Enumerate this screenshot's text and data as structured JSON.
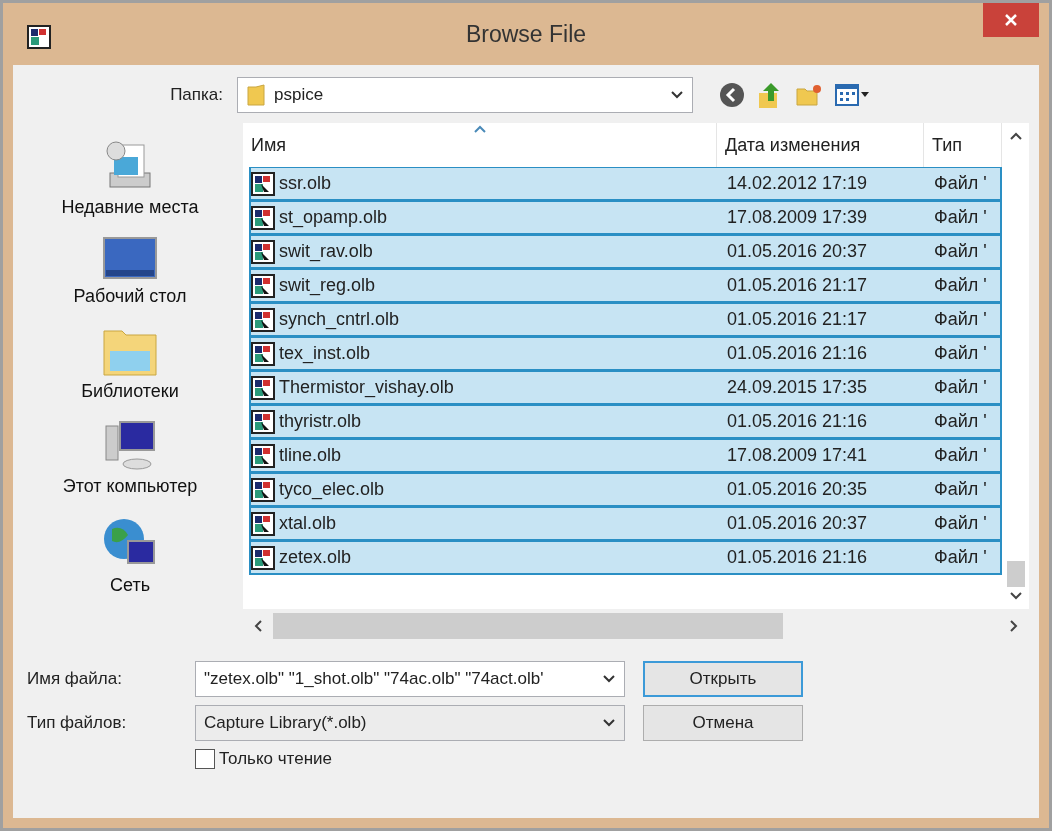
{
  "window": {
    "title": "Browse File"
  },
  "folder": {
    "label": "Папка:",
    "value": "pspice"
  },
  "places": [
    {
      "label": "Недавние места",
      "kind": "recent"
    },
    {
      "label": "Рабочий стол",
      "kind": "desktop"
    },
    {
      "label": "Библиотеки",
      "kind": "libraries"
    },
    {
      "label": "Этот компьютер",
      "kind": "computer"
    },
    {
      "label": "Сеть",
      "kind": "network"
    }
  ],
  "file_list": {
    "columns": [
      {
        "label": "Имя",
        "sorted": true
      },
      {
        "label": "Дата изменения",
        "sorted": false
      },
      {
        "label": "Тип",
        "sorted": false
      }
    ],
    "rows": [
      {
        "name": "ssr.olb",
        "date": "14.02.2012 17:19",
        "type": "Файл '",
        "selected": true
      },
      {
        "name": "st_opamp.olb",
        "date": "17.08.2009 17:39",
        "type": "Файл '",
        "selected": true
      },
      {
        "name": "swit_rav.olb",
        "date": "01.05.2016 20:37",
        "type": "Файл '",
        "selected": true
      },
      {
        "name": "swit_reg.olb",
        "date": "01.05.2016 21:17",
        "type": "Файл '",
        "selected": true
      },
      {
        "name": "synch_cntrl.olb",
        "date": "01.05.2016 21:17",
        "type": "Файл '",
        "selected": true
      },
      {
        "name": "tex_inst.olb",
        "date": "01.05.2016 21:16",
        "type": "Файл '",
        "selected": true
      },
      {
        "name": "Thermistor_vishay.olb",
        "date": "24.09.2015 17:35",
        "type": "Файл '",
        "selected": true
      },
      {
        "name": "thyristr.olb",
        "date": "01.05.2016 21:16",
        "type": "Файл '",
        "selected": true
      },
      {
        "name": "tline.olb",
        "date": "17.08.2009 17:41",
        "type": "Файл '",
        "selected": true
      },
      {
        "name": "tyco_elec.olb",
        "date": "01.05.2016 20:35",
        "type": "Файл '",
        "selected": true
      },
      {
        "name": "xtal.olb",
        "date": "01.05.2016 20:37",
        "type": "Файл '",
        "selected": true
      },
      {
        "name": "zetex.olb",
        "date": "01.05.2016 21:16",
        "type": "Файл '",
        "selected": true
      }
    ]
  },
  "file_name": {
    "label": "Имя файла:",
    "value": "\"zetex.olb\" \"1_shot.olb\" \"74ac.olb\" \"74act.olb'"
  },
  "file_type": {
    "label": "Тип файлов:",
    "value": "Capture Library(*.olb)"
  },
  "read_only": {
    "label": "Только чтение",
    "checked": false
  },
  "buttons": [
    "Открыть",
    "Отмена"
  ]
}
